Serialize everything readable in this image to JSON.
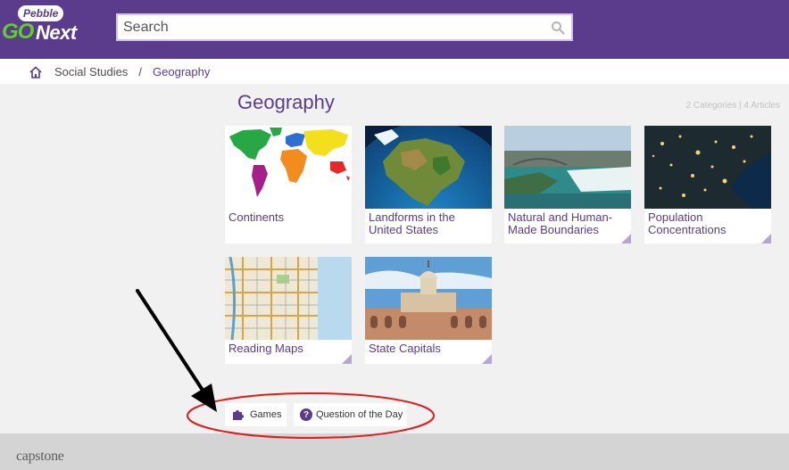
{
  "header": {
    "logo": {
      "top_word": "Pebble",
      "go_word": "GO",
      "next_word": "Next"
    },
    "search": {
      "placeholder": "Search"
    }
  },
  "breadcrumb": {
    "items": [
      {
        "label": "Social Studies"
      },
      {
        "label": "Geography"
      }
    ],
    "separator": "/"
  },
  "main": {
    "title": "Geography",
    "counts": "2 Categories | 4 Articles",
    "cards": [
      {
        "label": "Continents"
      },
      {
        "label": "Landforms in the United States"
      },
      {
        "label": "Natural and Human-Made Boundaries"
      },
      {
        "label": "Population Concentrations"
      },
      {
        "label": "Reading Maps"
      },
      {
        "label": "State Capitals"
      }
    ],
    "buttons": {
      "games": "Games",
      "question": "Question of the Day"
    }
  },
  "footer": {
    "brand": "capstone"
  },
  "colors": {
    "brand_purple": "#5a3b8c",
    "annotation_red": "#e01b1b"
  }
}
